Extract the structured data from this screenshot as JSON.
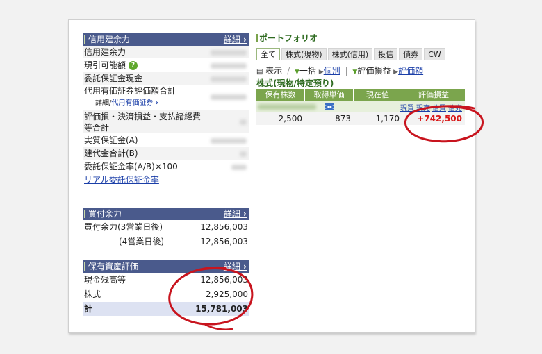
{
  "credit": {
    "title": "信用建余力",
    "detail_label": "詳細",
    "rows": [
      {
        "label": "信用建余力"
      },
      {
        "label": "現引可能額",
        "help": "?"
      },
      {
        "label": "委託保証金現金"
      },
      {
        "label": "代用有価証券評価額合計"
      },
      {
        "label": "評価損・決済損益・支払諸経費等合計"
      },
      {
        "label": "実質保証金(A)"
      },
      {
        "label": "建代金合計(B)"
      },
      {
        "label": "委託保証金率(A/B)×100"
      }
    ],
    "sub_detail_prefix": "詳細/",
    "sub_detail_link": "代用有価証券",
    "realtime_link": "リアル委託保証金率"
  },
  "buying": {
    "title": "買付余力",
    "detail_label": "詳細",
    "rows": [
      {
        "label": "買付余力(3営業日後)",
        "value": "12,856,003"
      },
      {
        "label": "(4営業日後)",
        "value": "12,856,003"
      }
    ]
  },
  "assets": {
    "title": "保有資産評価",
    "detail_label": "詳細",
    "rows": [
      {
        "label": "現金残高等",
        "value": "12,856,003"
      },
      {
        "label": "株式",
        "value": "2,925,000"
      }
    ],
    "total_label": "計",
    "total_value": "15,781,003"
  },
  "portfolio": {
    "title": "ポートフォリオ",
    "tabs": [
      "全て",
      "株式(現物)",
      "株式(信用)",
      "投信",
      "債券",
      "CW"
    ],
    "tools": {
      "display": "表示",
      "bulk": "一括",
      "individual": "個別",
      "eval_pl": "評価損益",
      "eval_amount": "評価額"
    },
    "section_title": "株式(現物/特定預り)",
    "columns": [
      "保有株数",
      "取得単価",
      "現在値",
      "評価損益"
    ],
    "actions": [
      "現買",
      "現売",
      "信買",
      "信売"
    ],
    "holding": {
      "shares": "2,500",
      "cost": "873",
      "price": "1,170",
      "pl": "+742,500"
    }
  },
  "colors": {
    "header_blue": "#4a5a8c",
    "header_green": "#7ba54d",
    "profit_red": "#d81818",
    "annotation_red": "#c8141e"
  }
}
